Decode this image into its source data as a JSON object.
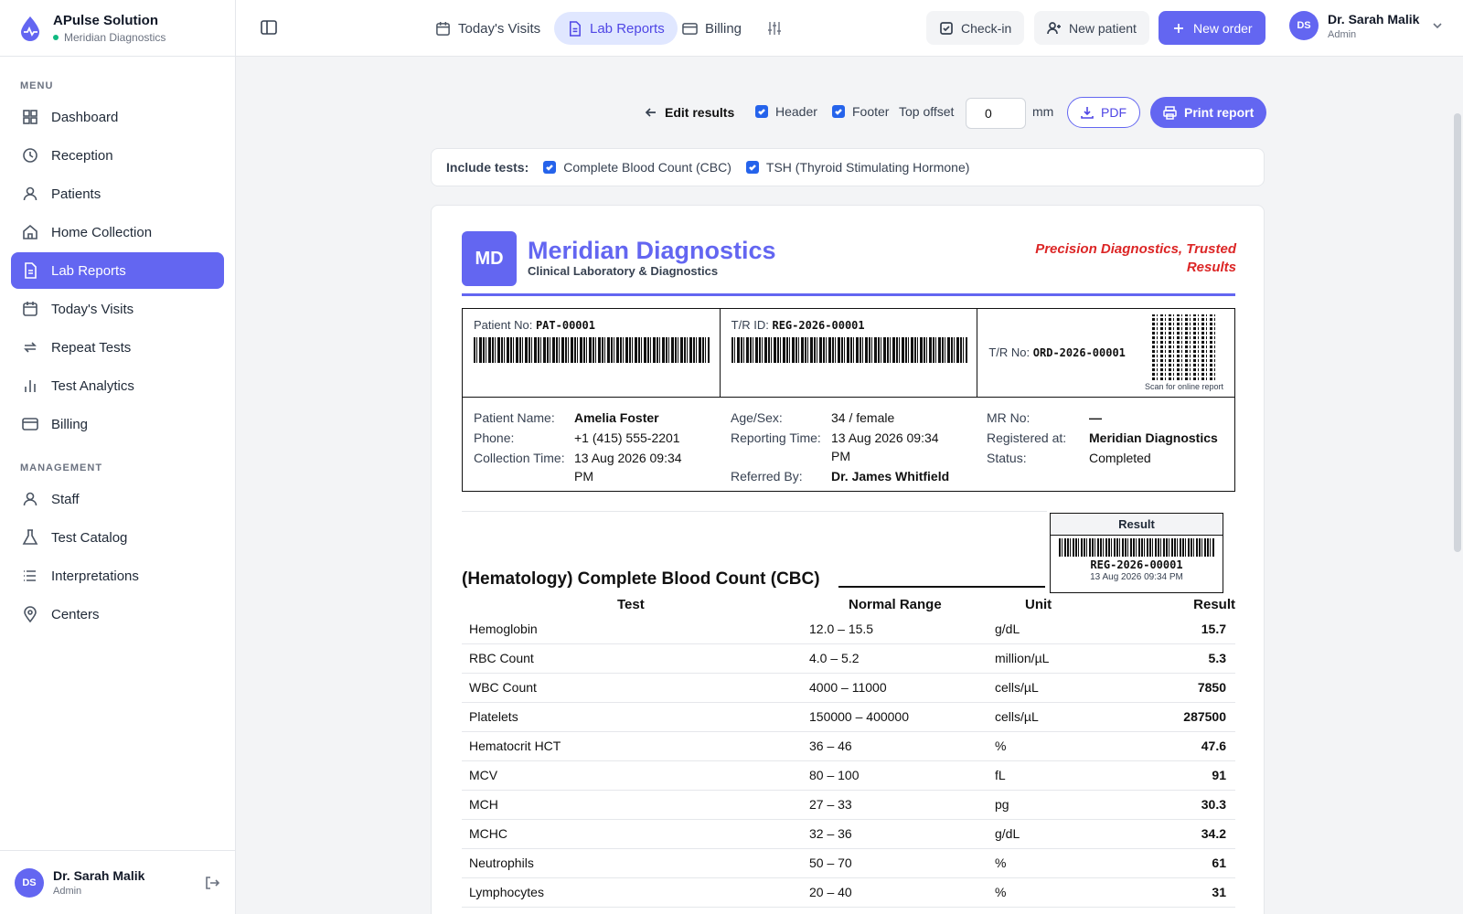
{
  "brand": {
    "name": "APulse Solution",
    "center": "Meridian Diagnostics"
  },
  "sidebar": {
    "menu_title": "MENU",
    "menu": [
      {
        "label": "Dashboard",
        "icon": "grid-icon"
      },
      {
        "label": "Reception",
        "icon": "clock-icon"
      },
      {
        "label": "Patients",
        "icon": "user-icon"
      },
      {
        "label": "Home Collection",
        "icon": "home-icon"
      },
      {
        "label": "Lab Reports",
        "icon": "file-icon",
        "active": true
      },
      {
        "label": "Today's Visits",
        "icon": "calendar-icon"
      },
      {
        "label": "Repeat Tests",
        "icon": "repeat-icon"
      },
      {
        "label": "Test Analytics",
        "icon": "bar-chart-icon"
      },
      {
        "label": "Billing",
        "icon": "card-icon"
      }
    ],
    "management_title": "MANAGEMENT",
    "management": [
      {
        "label": "Staff",
        "icon": "user-icon"
      },
      {
        "label": "Test Catalog",
        "icon": "flask-icon"
      },
      {
        "label": "Interpretations",
        "icon": "list-icon"
      },
      {
        "label": "Centers",
        "icon": "map-pin-icon"
      }
    ],
    "user": {
      "initials": "DS",
      "name": "Dr. Sarah Malik",
      "role": "Admin"
    }
  },
  "topbar": {
    "tabs": [
      "Today's Visits",
      "Lab Reports",
      "Billing"
    ],
    "checkin": "Check-in",
    "new_patient": "New patient",
    "new_order": "New order",
    "user": {
      "initials": "DS",
      "name": "Dr. Sarah Malik",
      "role": "Admin"
    }
  },
  "toolbar": {
    "edit_results": "Edit results",
    "header": "Header",
    "footer": "Footer",
    "top_offset": "Top offset",
    "offset_value": "0",
    "unit": "mm",
    "pdf": "PDF",
    "print": "Print report"
  },
  "include": {
    "label": "Include tests:",
    "tests": [
      "Complete Blood Count (CBC)",
      "TSH (Thyroid Stimulating Hormone)"
    ]
  },
  "report": {
    "logo": "MD",
    "lab_name": "Meridian Diagnostics",
    "lab_sub": "Clinical Laboratory & Diagnostics",
    "tagline": "Precision Diagnostics, Trusted Results",
    "patient_no_label": "Patient No:",
    "patient_no": "PAT-00001",
    "tr_id_label": "T/R ID:",
    "tr_id": "REG-2026-00001",
    "tr_no_label": "T/R No:",
    "tr_no": "ORD-2026-00001",
    "qr_caption": "Scan for online report",
    "info": {
      "patient_name_label": "Patient Name:",
      "patient_name": "Amelia Foster",
      "phone_label": "Phone:",
      "phone": "+1 (415) 555-2201",
      "collection_label": "Collection Time:",
      "collection_1": "13 Aug 2026 09:34",
      "collection_2": "PM",
      "age_label": "Age/Sex:",
      "age": "34 / female",
      "reporting_label": "Reporting Time:",
      "reporting_1": "13 Aug 2026 09:34",
      "reporting_2": "PM",
      "referred_label": "Referred By:",
      "referred": "Dr. James Whitfield",
      "mr_label": "MR No:",
      "mr": "—",
      "registered_label": "Registered at:",
      "registered": "Meridian Diagnostics",
      "status_label": "Status:",
      "status": "Completed"
    },
    "result_box": {
      "title": "Result",
      "id": "REG-2026-00001",
      "date": "13 Aug 2026 09:34 PM"
    },
    "section_title": "(Hematology) Complete Blood Count (CBC)",
    "columns": [
      "Test",
      "Normal Range",
      "Unit",
      "Result"
    ],
    "rows": [
      [
        "Hemoglobin",
        "12.0 – 15.5",
        "g/dL",
        "15.7"
      ],
      [
        "RBC Count",
        "4.0 – 5.2",
        "million/µL",
        "5.3"
      ],
      [
        "WBC Count",
        "4000 – 11000",
        "cells/µL",
        "7850"
      ],
      [
        "Platelets",
        "150000 – 400000",
        "cells/µL",
        "287500"
      ],
      [
        "Hematocrit HCT",
        "36 – 46",
        "%",
        "47.6"
      ],
      [
        "MCV",
        "80 – 100",
        "fL",
        "91"
      ],
      [
        "MCH",
        "27 – 33",
        "pg",
        "30.3"
      ],
      [
        "MCHC",
        "32 – 36",
        "g/dL",
        "34.2"
      ],
      [
        "Neutrophils",
        "50 – 70",
        "%",
        "61"
      ],
      [
        "Lymphocytes",
        "20 – 40",
        "%",
        "31"
      ]
    ]
  }
}
